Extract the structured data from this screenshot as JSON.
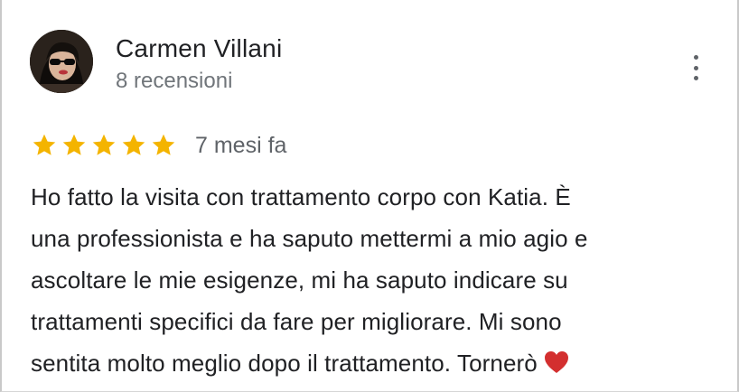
{
  "review": {
    "author": {
      "name": "Carmen Villani",
      "reviews_count": "8 recensioni"
    },
    "rating": {
      "stars": 5,
      "max": 5
    },
    "date": "7 mesi fa",
    "text": "Ho fatto  la visita con trattamento corpo con Katia. È\nuna professionista e ha saputo mettermi a mio agio e\nascoltare le mie esigenze, mi ha saputo indicare su\ntrattamenti specifici da fare per migliorare. Mi sono\nsentita molto meglio dopo il trattamento. Tornerò",
    "emoji": "heart-emoji"
  },
  "colors": {
    "star": "#f4b400",
    "name": "#202124",
    "secondary": "#70757a",
    "heart": "#d32f2f"
  },
  "icons": {
    "more": "more-vert-icon",
    "star": "star-icon"
  }
}
